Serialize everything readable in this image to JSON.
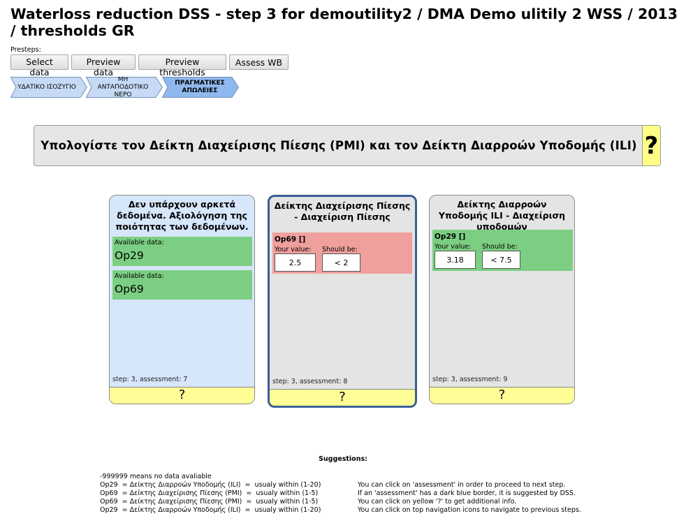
{
  "page_title": "Waterloss reduction DSS - step 3 for demoutility2 / DMA Demo ulitily 2 WSS / 2013 / thresholds GR",
  "presteps": {
    "label": "Presteps:",
    "buttons": [
      "Select data",
      "Preview data",
      "Preview thresholds",
      "Assess WB"
    ]
  },
  "breadcrumb": {
    "items": [
      {
        "label": "ΥΔΑΤΙΚΟ ΙΣΟΖΥΓΙΟ",
        "active": false
      },
      {
        "label": "ΜΗ ΑΝΤΑΠΟΔΟΤΙΚΟ ΝΕΡΟ",
        "active": false
      },
      {
        "label": "ΠΡΑΓΜΑΤΙΚΕΣ ΑΠΩΛΕΙΕΣ",
        "active": true
      }
    ],
    "colors": {
      "inactive": "#c6daf5",
      "active": "#8fb8ee",
      "border": "#6f8fb8"
    }
  },
  "banner": {
    "text": "Υπολογίστε τον Δείκτη Διαχείρισης Πίεσης (PMI) και τον Δείκτη Διαρροών Υποδομής (ILI)",
    "help": "?"
  },
  "cards": [
    {
      "title": "Δεν υπάρχουν αρκετά δεδομένα. Αξιολόγηση της ποιότητας των δεδομένων.",
      "available_label": "Available data:",
      "available": [
        "Op29",
        "Op69"
      ],
      "step": "step: 3, assessment: 7",
      "help": "?",
      "bg": "#d6e6fb"
    },
    {
      "title": "Δείκτης Διαχείρισης Πίεσης - Διαχείριση Πίεσης",
      "indicator": {
        "name": "Op69 []",
        "your_value_label": "Your value:",
        "should_be_label": "Should be:",
        "your_value": "2.5",
        "should_be": "<  2",
        "status": "bad"
      },
      "step": "step: 3, assessment: 8",
      "help": "?",
      "bg": "#e4e4e4"
    },
    {
      "title": "Δείκτης Διαρροών Υποδομής ILI - Διαχείριση υποδομών",
      "indicator": {
        "name": "Op29 []",
        "your_value_label": "Your value:",
        "should_be_label": "Should be:",
        "your_value": "3.18",
        "should_be": "<  7.5",
        "status": "good"
      },
      "step": "step: 3, assessment: 9",
      "help": "?",
      "bg": "#e4e4e4"
    }
  ],
  "suggestions": {
    "title": "Suggestions:",
    "left": [
      "-999999 means no data avaliable",
      "Op29  = Δείκτης Διαρροών Υποδομής (ILI)  =  usualy within (1-20)",
      "Op69  = Δείκτης Διαχείρισης Πίεσης (PMI)  =  usualy within (1-5)",
      "Op69  = Δείκτης Διαχείρισης Πίεσης (PMI)  =  usualy within (1-5)",
      "Op29  = Δείκτης Διαρροών Υποδομής (ILI)  =  usualy within (1-20)"
    ],
    "right": [
      "You can click on 'assessment' in order to proceed to next step.",
      "If an 'assessment' has a dark blue border, it is suggested by DSS.",
      "You can click on yellow '?' to get additional info.",
      "You can click on top navigation icons to navigate to previous steps."
    ]
  },
  "colors": {
    "good": "#7ccf82",
    "bad": "#efa09c",
    "help": "#fffd95",
    "selected_border": "#3a5f96"
  }
}
